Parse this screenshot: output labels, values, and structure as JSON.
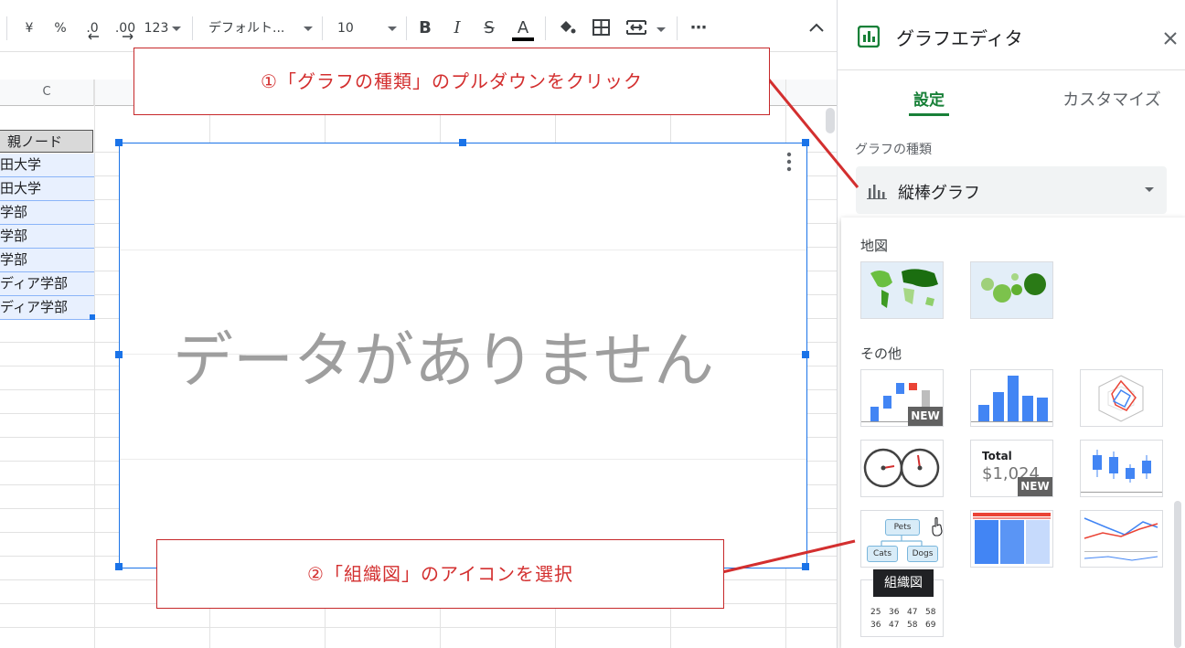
{
  "toolbar": {
    "currency": "¥",
    "percent": "%",
    "dec_less": ".0",
    "dec_more": ".00",
    "number_format": "123",
    "font": "デフォルト...",
    "font_size": "10",
    "bold": "B",
    "italic": "I",
    "strike": "S",
    "text_color": "A",
    "more": "⋯",
    "text_color_value": "#000000"
  },
  "sheet": {
    "column_c": "C",
    "cells": [
      "親ノード",
      "田大学",
      "田大学",
      "学部",
      "学部",
      "学部",
      "ディア学部",
      "ディア学部"
    ]
  },
  "chart": {
    "empty_message": "データがありません"
  },
  "callouts": {
    "step1": "①「グラフの種類」のプルダウンをクリック",
    "step2": "②「組織図」のアイコンを選択"
  },
  "editor": {
    "title": "グラフエディタ",
    "tabs": [
      {
        "label": "設定",
        "active": true
      },
      {
        "label": "カスタマイズ",
        "active": false
      }
    ],
    "chart_type_label": "グラフの種類",
    "chart_type_value": "縦棒グラフ",
    "sections": {
      "map": "地図",
      "other": "その他"
    },
    "badges": {
      "new1": "NEW",
      "new2": "NEW"
    },
    "scorecard": {
      "title": "Total",
      "value": "$1,024"
    },
    "org_chart": {
      "pets": "Pets",
      "cats": "Cats",
      "dogs": "Dogs"
    },
    "tooltip": "組織図",
    "table_thumb": {
      "rows": [
        [
          "25",
          "36",
          "47",
          "58"
        ],
        [
          "36",
          "47",
          "58",
          "69"
        ]
      ]
    }
  },
  "colors": {
    "accent": "#1a73e8",
    "active_tab": "#188038",
    "callout_red": "#d32f2f",
    "header_fill": "#d9d9d9",
    "selected_cell": "#e8f0fe"
  }
}
